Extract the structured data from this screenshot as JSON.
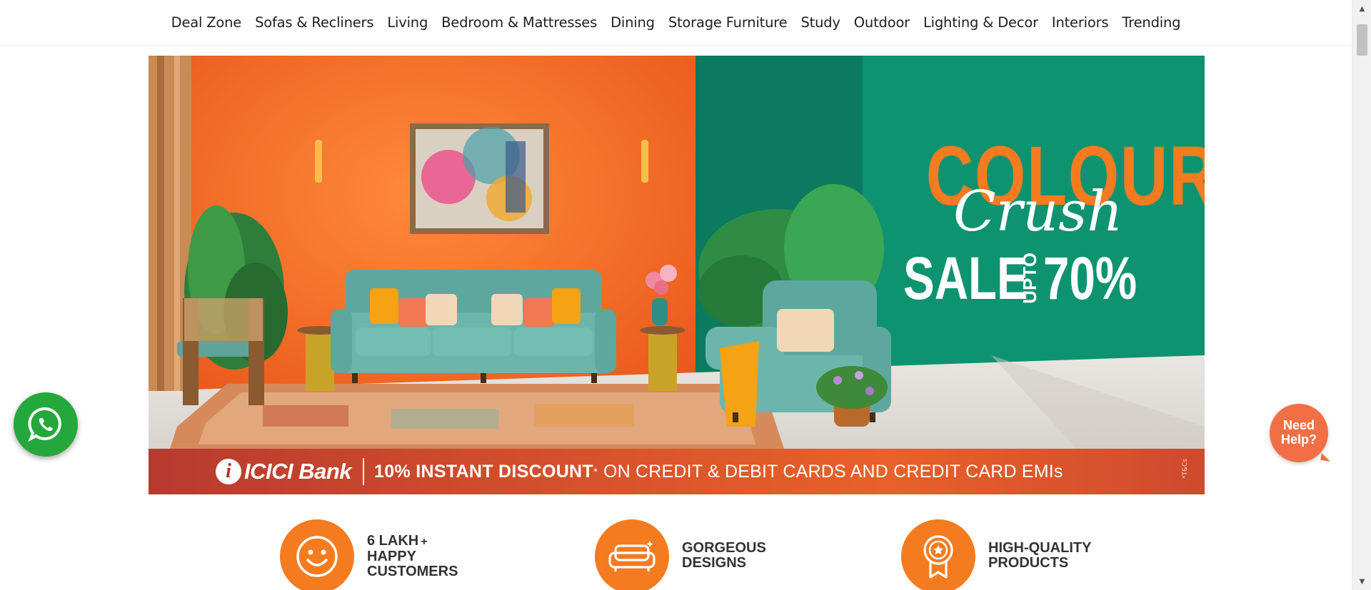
{
  "nav": {
    "items": [
      "Deal Zone",
      "Sofas & Recliners",
      "Living",
      "Bedroom & Mattresses",
      "Dining",
      "Storage Furniture",
      "Study",
      "Outdoor",
      "Lighting & Decor",
      "Interiors",
      "Trending"
    ]
  },
  "hero": {
    "headline_top": "COLOUR",
    "headline_script": "Crush",
    "headline_sale": "SALE",
    "headline_upto": "UPTO",
    "headline_percent": "70%",
    "bank_name": "ICICI Bank",
    "bank_mark": "i",
    "offer_bold": "10% INSTANT DISCOUNT",
    "offer_mark": "*",
    "offer_rest": "ON CREDIT & DEBIT CARDS AND CREDIT CARD EMIs",
    "tnc": "*T&Cs",
    "colors": {
      "orange_wall": "#f26a1f",
      "green_wall": "#0e8f6e",
      "strip": "#d9542b"
    }
  },
  "floating": {
    "whatsapp_icon": "whatsapp-icon",
    "help_line1": "Need",
    "help_line2": "Help?"
  },
  "usps": [
    {
      "icon": "smiley-icon",
      "line1": "6 LAKH",
      "plus": "+",
      "line2": "HAPPY",
      "line3": "CUSTOMERS"
    },
    {
      "icon": "sofa-icon",
      "line1": "GORGEOUS",
      "line2": "DESIGNS"
    },
    {
      "icon": "award-icon",
      "line1": "HIGH-QUALITY",
      "line2": "PRODUCTS"
    }
  ]
}
